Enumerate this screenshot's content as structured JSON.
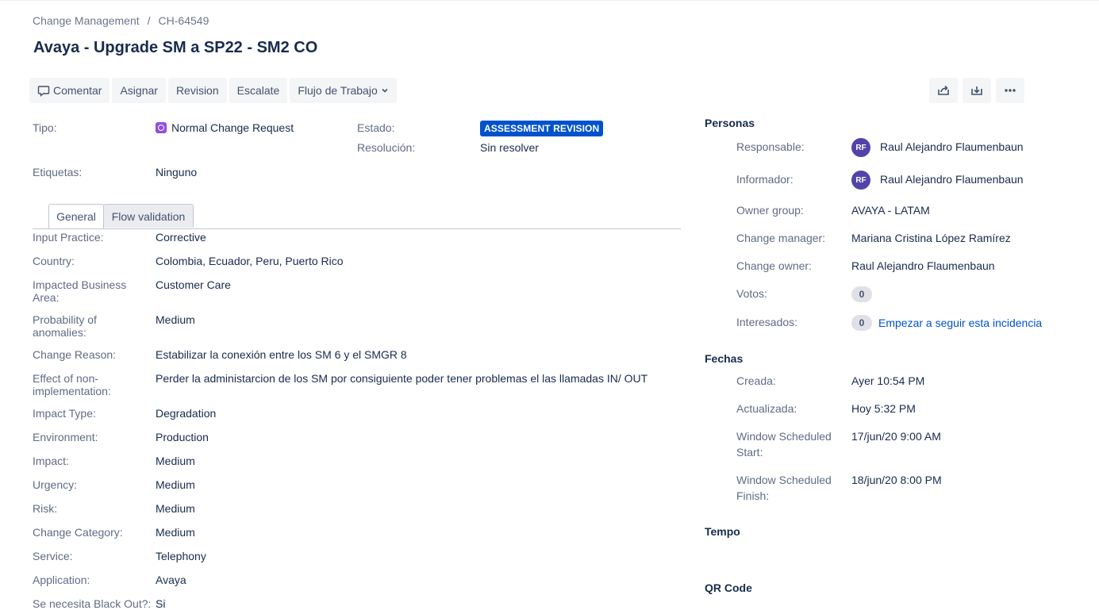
{
  "breadcrumb": {
    "project": "Change Management",
    "separator": "/",
    "issue_key": "CH-64549"
  },
  "title": "Avaya - Upgrade SM a SP22 - SM2 CO",
  "toolbar": {
    "comment": "Comentar",
    "assign": "Asignar",
    "revision": "Revision",
    "escalate": "Escalate",
    "workflow": "Flujo de Trabajo"
  },
  "details": {
    "type_label": "Tipo:",
    "type_value": "Normal Change Request",
    "status_label": "Estado:",
    "status_value": "ASSESSMENT REVISION",
    "resolution_label": "Resolución:",
    "resolution_value": "Sin resolver",
    "labels_label": "Etiquetas:",
    "labels_value": "Ninguno"
  },
  "tabs": [
    "General",
    "Flow validation"
  ],
  "fields": [
    {
      "label": "Input Practice:",
      "value": "Corrective"
    },
    {
      "label": "Country:",
      "value": "Colombia, Ecuador, Peru, Puerto Rico"
    },
    {
      "label": "Impacted Business Area:",
      "value": "Customer Care"
    },
    {
      "label": "Probability of anomalies:",
      "value": "Medium"
    },
    {
      "label": "Change Reason:",
      "value": "Estabilizar la conexión entre los SM 6 y el SMGR 8"
    },
    {
      "label": "Effect of non-implementation:",
      "value": "Perder la administarcion de los SM por consiguiente poder tener problemas el las llamadas IN/ OUT"
    },
    {
      "label": "Impact Type:",
      "value": "Degradation"
    },
    {
      "label": "Environment:",
      "value": "Production"
    },
    {
      "label": "Impact:",
      "value": "Medium"
    },
    {
      "label": "Urgency:",
      "value": "Medium"
    },
    {
      "label": "Risk:",
      "value": "Medium"
    },
    {
      "label": "Change Category:",
      "value": "Medium"
    },
    {
      "label": "Service:",
      "value": "Telephony"
    },
    {
      "label": "Application:",
      "value": "Avaya"
    },
    {
      "label": "Se necesita Black Out?:",
      "value": "Si"
    }
  ],
  "people": {
    "title": "Personas",
    "assignee_label": "Responsable:",
    "assignee_initials": "RF",
    "assignee_name": "Raul Alejandro Flaumenbaun",
    "reporter_label": "Informador:",
    "reporter_initials": "RF",
    "reporter_name": "Raul Alejandro Flaumenbaun",
    "owner_group_label": "Owner group:",
    "owner_group_value": "AVAYA - LATAM",
    "change_manager_label": "Change manager:",
    "change_manager_value": "Mariana Cristina López Ramírez",
    "change_owner_label": "Change owner:",
    "change_owner_value": "Raul Alejandro Flaumenbaun",
    "votes_label": "Votos:",
    "votes_count": "0",
    "watchers_label": "Interesados:",
    "watchers_count": "0",
    "watch_link": "Empezar a seguir esta incidencia"
  },
  "dates": {
    "title": "Fechas",
    "created_label": "Creada:",
    "created_value": "Ayer 10:54 PM",
    "updated_label": "Actualizada:",
    "updated_value": "Hoy 5:32 PM",
    "window_start_label": "Window Scheduled Start:",
    "window_start_value": "17/jun/20 9:00 AM",
    "window_finish_label": "Window Scheduled Finish:",
    "window_finish_value": "18/jun/20 8:00 PM"
  },
  "tempo_title": "Tempo",
  "qr_title": "QR Code",
  "colors": {
    "status_blue": "#0052cc",
    "avatar_purple": "#5243aa",
    "type_purple": "#904ee2"
  }
}
